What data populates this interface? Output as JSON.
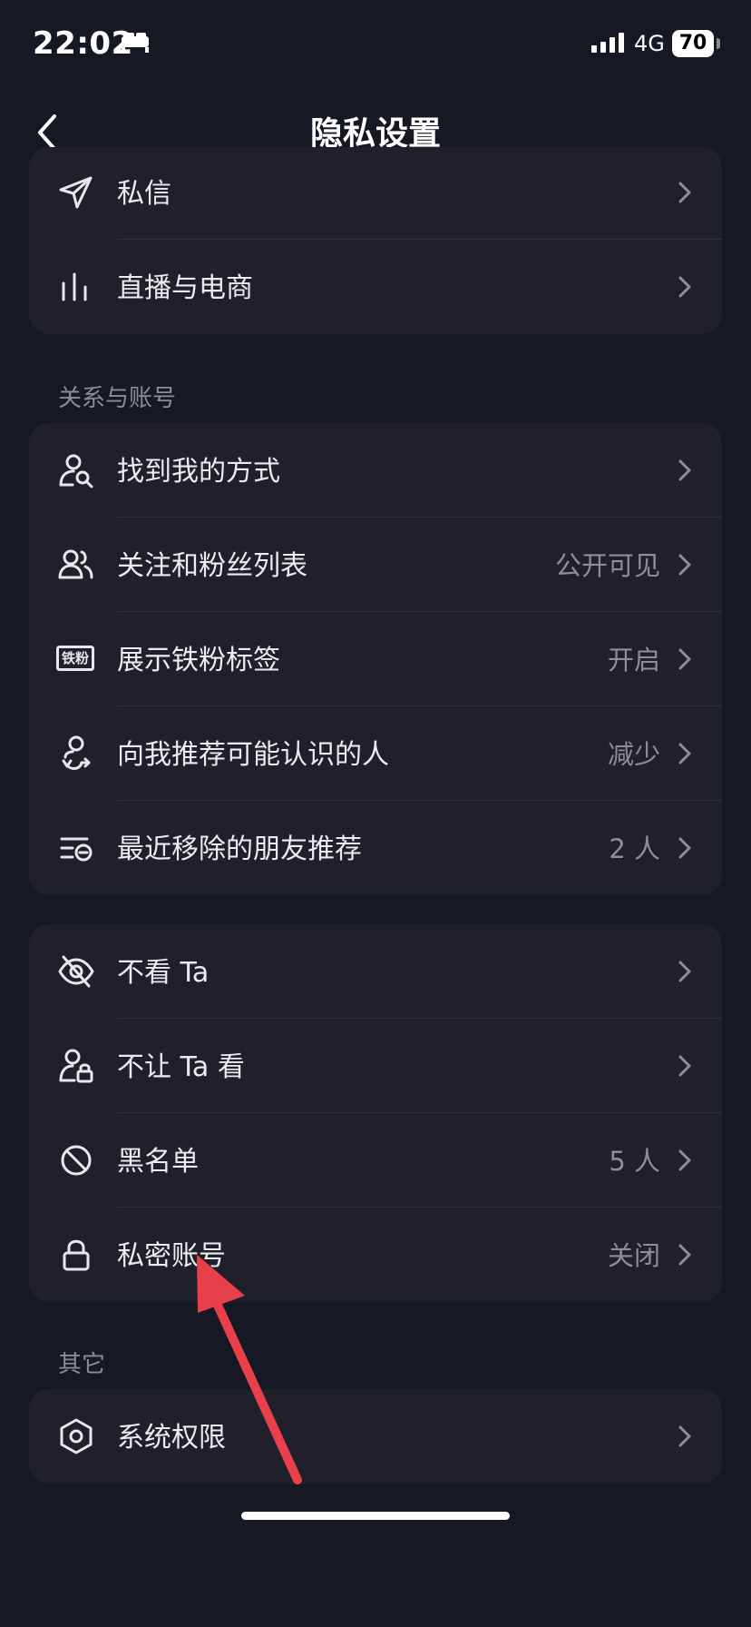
{
  "status": {
    "time": "22:02",
    "network": "4G",
    "battery": "70"
  },
  "header": {
    "title": "隐私设置"
  },
  "card_top": [
    {
      "label": "私信",
      "value": "",
      "icon": "paper-plane-icon"
    },
    {
      "label": "直播与电商",
      "value": "",
      "icon": "bars-icon"
    }
  ],
  "section_relations": {
    "title": "关系与账号"
  },
  "card_relations": [
    {
      "label": "找到我的方式",
      "value": "",
      "icon": "user-search-icon"
    },
    {
      "label": "关注和粉丝列表",
      "value": "公开可见",
      "icon": "users-icon"
    },
    {
      "label": "展示铁粉标签",
      "value": "开启",
      "icon": "tiefen-badge-icon",
      "badge_text": "铁粉"
    },
    {
      "label": "向我推荐可能认识的人",
      "value": "减少",
      "icon": "user-recommend-icon"
    },
    {
      "label": "最近移除的朋友推荐",
      "value": "2 人",
      "icon": "list-removed-icon"
    }
  ],
  "card_visibility": [
    {
      "label": "不看 Ta",
      "value": "",
      "icon": "eye-off-icon"
    },
    {
      "label": "不让 Ta 看",
      "value": "",
      "icon": "user-lock-icon"
    },
    {
      "label": "黑名单",
      "value": "5 人",
      "icon": "block-icon"
    },
    {
      "label": "私密账号",
      "value": "关闭",
      "icon": "lock-icon"
    }
  ],
  "section_other": {
    "title": "其它"
  },
  "card_other": [
    {
      "label": "系统权限",
      "value": "",
      "icon": "hexagon-settings-icon"
    }
  ],
  "colors": {
    "background": "#161823",
    "card": "#1f2029",
    "annotation_arrow": "#e8404a"
  }
}
